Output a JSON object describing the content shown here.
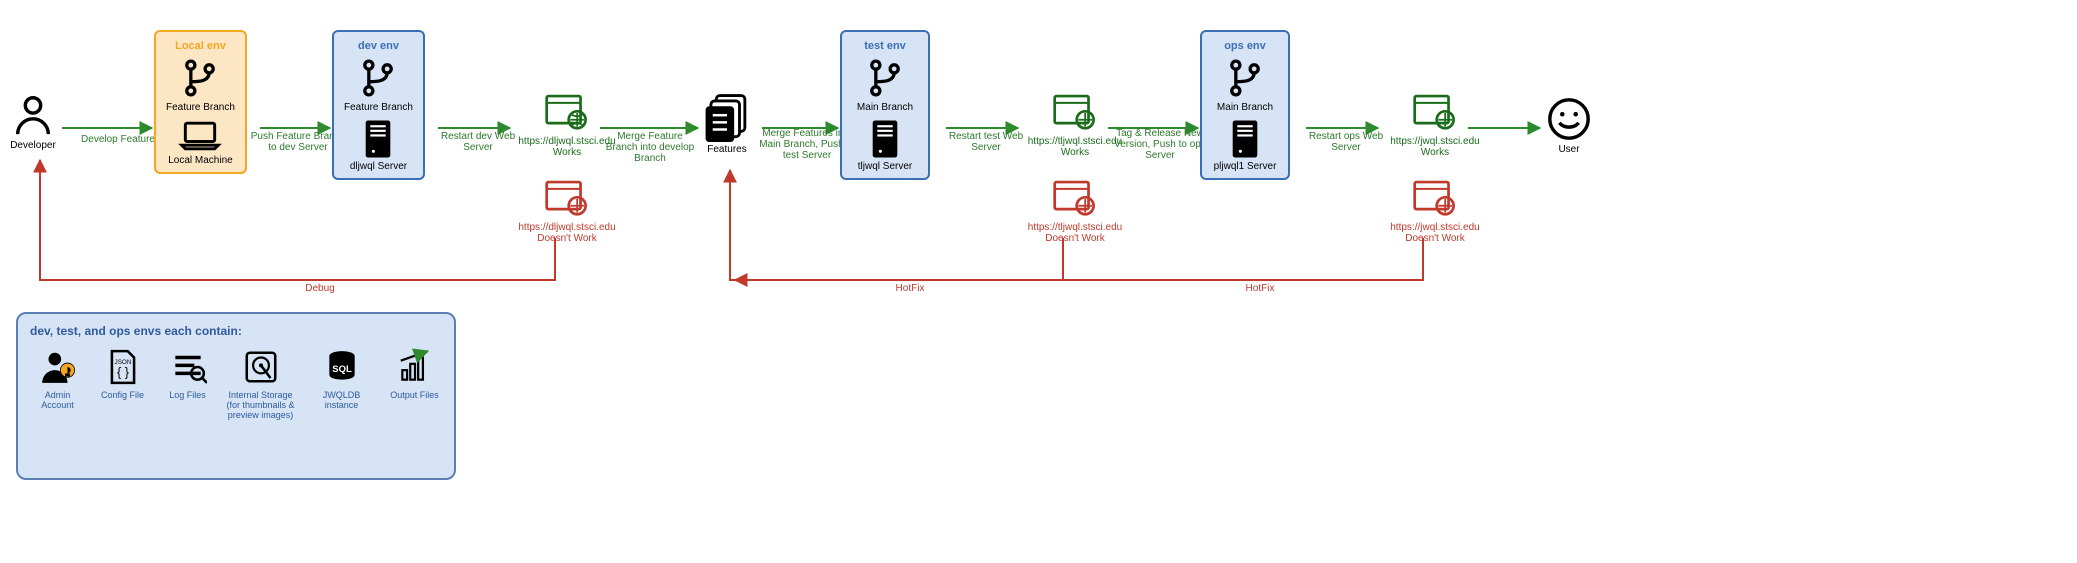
{
  "actors": {
    "developer": "Developer",
    "user": "User"
  },
  "envs": {
    "local": {
      "title": "Local env",
      "branch": "Feature Branch",
      "machine": "Local Machine"
    },
    "dev": {
      "title": "dev env",
      "branch": "Feature Branch",
      "server": "dljwql Server"
    },
    "test": {
      "title": "test env",
      "branch": "Main Branch",
      "server": "tljwql Server"
    },
    "ops": {
      "title": "ops env",
      "branch": "Main Branch",
      "server": "pljwql1 Server"
    }
  },
  "features_label": "Features",
  "arrows": {
    "develop_feature": "Develop Feature",
    "push_to_dev": "Push Feature Branch to dev Server",
    "restart_dev": "Restart dev Web Server",
    "merge_into_develop": "Merge Feature Branch into develop Branch",
    "merge_into_main": "Merge Features into Main Branch, Push to test Server",
    "restart_test": "Restart test Web Server",
    "tag_release": "Tag & Release New Version, Push to ops Server",
    "restart_ops": "Restart ops Web Server",
    "debug": "Debug",
    "hotfix": "HotFix"
  },
  "status": {
    "dev_ok": "https://dljwql.stsci.edu Works",
    "dev_bad": "https://dljwql.stsci.edu Doesn't Work",
    "test_ok": "https://tljwql.stsci.edu Works",
    "test_bad": "https://tljwql.stsci.edu Doesn't Work",
    "ops_ok": "https://jwql.stsci.edu Works",
    "ops_bad": "https://jwql.stsci.edu Doesn't Work"
  },
  "legend": {
    "title": "dev, test, and ops envs each contain:",
    "items": {
      "admin": "Admin Account",
      "config": "Config File",
      "logs": "Log Files",
      "storage": "Internal Storage (for thumbnails & preview images)",
      "db": "JWQLDB instance",
      "output": "Output Files"
    }
  }
}
